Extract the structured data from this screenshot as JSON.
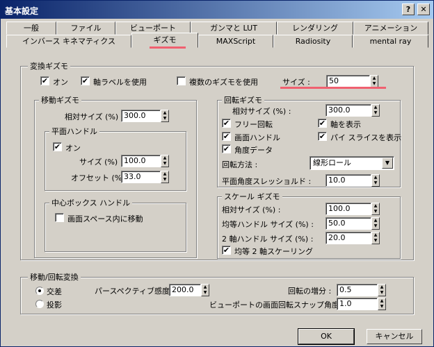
{
  "window": {
    "title": "基本設定",
    "help_label": "?",
    "close_label": "✕"
  },
  "tabs_row1": [
    "一般",
    "ファイル",
    "ビューポート",
    "ガンマと LUT",
    "レンダリング",
    "アニメーション"
  ],
  "tabs_row2": [
    "インバース キネマティクス",
    "ギズモ",
    "MAXScript",
    "Radiosity",
    "mental ray"
  ],
  "transform": {
    "title": "変換ギズモ",
    "on_label": "オン",
    "on_checked": true,
    "axis_label": "軸ラベルを使用",
    "axis_checked": true,
    "multi_label": "複数のギズモを使用",
    "multi_checked": false,
    "size_label": "サイズ :",
    "size_value": "50"
  },
  "move": {
    "title": "移動ギズモ",
    "relsize_label": "相対サイズ (%) :",
    "relsize_value": "300.0",
    "plane": {
      "title": "平面ハンドル",
      "on_label": "オン",
      "on_checked": true,
      "size_label": "サイズ (%) :",
      "size_value": "100.0",
      "offset_label": "オフセット (%) :",
      "offset_value": "33.0"
    },
    "center": {
      "title": "中心ボックス ハンドル",
      "screen_label": "画面スペース内に移動",
      "screen_checked": false
    }
  },
  "rotate": {
    "title": "回転ギズモ",
    "relsize_label": "相対サイズ (%) :",
    "relsize_value": "300.0",
    "free_label": "フリー回転",
    "free_checked": true,
    "showaxis_label": "軸を表示",
    "showaxis_checked": true,
    "screen_label": "画面ハンドル",
    "screen_checked": true,
    "pie_label": "パイ スライスを表示",
    "pie_checked": true,
    "angle_label": "角度データ",
    "angle_checked": true,
    "method_label": "回転方法 :",
    "method_value": "線形ロール",
    "threshold_label": "平面角度スレッショルド :",
    "threshold_value": "10.0"
  },
  "scale": {
    "title": "スケール ギズモ",
    "relsize_label": "相対サイズ (%) :",
    "relsize_value": "100.0",
    "uniform_label": "均等ハンドル サイズ (%) :",
    "uniform_value": "50.0",
    "twoaxis_label": "2 軸ハンドル サイズ (%) :",
    "twoaxis_value": "20.0",
    "uniform2_label": "均等 2 軸スケーリング",
    "uniform2_checked": true
  },
  "moverot": {
    "title": "移動/回転変換",
    "cross_label": "交差",
    "cross_selected": true,
    "project_label": "投影",
    "project_selected": false,
    "persp_label": "パースペクティブ感度 :",
    "persp_value": "200.0",
    "rotinc_label": "回転の増分 :",
    "rotinc_value": "0.5",
    "snap_label": "ビューポートの画面回転スナップ角度 :",
    "snap_value": "1.0"
  },
  "buttons": {
    "ok": "OK",
    "cancel": "キャンセル"
  },
  "colors": {
    "title_from": "#0a246a",
    "title_to": "#a6caf0",
    "highlight": "#f06070"
  }
}
